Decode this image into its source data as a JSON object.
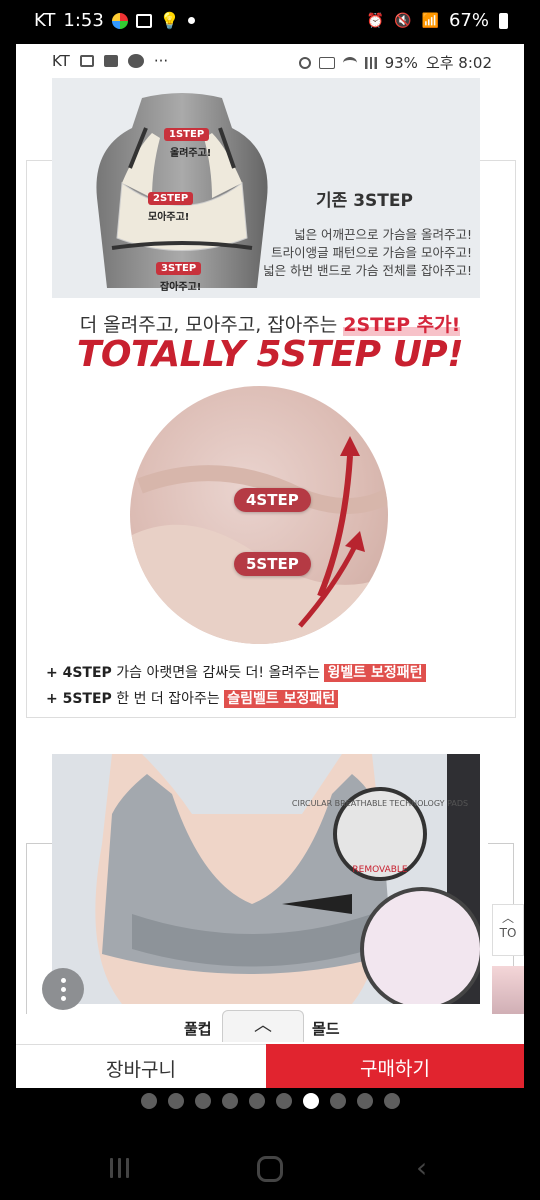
{
  "status_bar": {
    "carrier": "KT",
    "time": "1:53",
    "battery": "67%"
  },
  "inner_status_bar": {
    "carrier": "KT",
    "more": "···",
    "battery": "93%",
    "time": "오후 8:02"
  },
  "product_detail": {
    "step_panel": {
      "title": "기존 3STEP",
      "desc_lines": [
        "넓은 어깨끈으로 가슴을 올려주고!",
        "트라이앵글 패턴으로 가슴을 모아주고!",
        "넓은 하번 밴드로 가슴 전체를 잡아주고!"
      ],
      "steps": [
        {
          "badge": "1STEP",
          "caption": "올려주고!"
        },
        {
          "badge": "2STEP",
          "caption": "모아주고!"
        },
        {
          "badge": "3STEP",
          "caption": "잡아주고!"
        }
      ]
    },
    "headline_prefix": "더 올려주고, 모아주고, 잡아주는 ",
    "headline_highlight": "2STEP 추가!",
    "headline_big": "TOTALLY 5STEP UP!",
    "circle_pills": [
      "4STEP",
      "5STEP"
    ],
    "features": [
      {
        "plus": "+ 4STEP",
        "text": " 가슴 아랫면을 감싸듯 더! 올려주는 ",
        "highlight": "윙벨트 보정패턴"
      },
      {
        "plus": "+ 5STEP",
        "text": " 한 번 더 잡아주는 ",
        "highlight": "슬림벨트 보정패턴"
      }
    ],
    "badge_ring_text": "CIRCULAR BREATHABLE TECHNOLOGY PADS",
    "removable_label": "REMOVABLE"
  },
  "side": {
    "top_button_label": "TO"
  },
  "tabs": {
    "left": "풀컵",
    "right": "몰드",
    "toggle_icon": "chevron-up-icon"
  },
  "bottom_bar": {
    "cart_label": "장바구니",
    "buy_label": "구매하기"
  },
  "page_indicator": {
    "count": 10,
    "active_index": 6
  },
  "colors": {
    "accent_red": "#e1242f",
    "headline_red": "#c8202f",
    "step_badge": "#c8323c"
  }
}
